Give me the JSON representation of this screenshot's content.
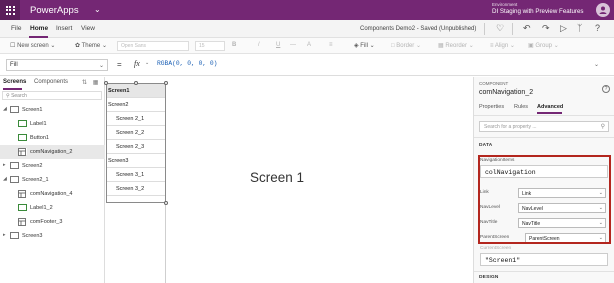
{
  "app": {
    "name": "PowerApps",
    "environment_label": "Environment",
    "environment_name": "DI Staging with Preview Features"
  },
  "menu": {
    "items": [
      "File",
      "Home",
      "Insert",
      "View"
    ],
    "active": "Home",
    "doc_title": "Components Demo2 - Saved (Unpublished)"
  },
  "toolbar": {
    "new_screen": "New screen",
    "theme": "Theme",
    "font": "Open Sans",
    "font_size": "15",
    "bold": "B",
    "italic": "/",
    "underline": "U",
    "strike": "—",
    "font_color": "A",
    "align": "≡",
    "fill": "Fill",
    "border": "Border",
    "reorder": "Reorder",
    "align_menu": "Align",
    "group": "Group"
  },
  "formula_bar": {
    "property": "Fill",
    "equals": "=",
    "fx": "fx",
    "formula": "RGBA(0, 0, 0, 0)"
  },
  "tree": {
    "tabs": [
      "Screens",
      "Components"
    ],
    "active_tab": "Screens",
    "search_placeholder": "Search",
    "rows": [
      {
        "label": "Screen1",
        "level": 0,
        "expanded": true,
        "kind": "screen"
      },
      {
        "label": "Label1",
        "level": 1,
        "kind": "label"
      },
      {
        "label": "Button1",
        "level": 1,
        "kind": "button"
      },
      {
        "label": "comNavigation_2",
        "level": 1,
        "kind": "component",
        "selected": true
      },
      {
        "label": "Screen2",
        "level": 0,
        "expanded": false,
        "kind": "screen"
      },
      {
        "label": "Screen2_1",
        "level": 0,
        "expanded": true,
        "kind": "screen"
      },
      {
        "label": "comNavigation_4",
        "level": 1,
        "kind": "component"
      },
      {
        "label": "Label1_2",
        "level": 1,
        "kind": "label"
      },
      {
        "label": "comFooter_3",
        "level": 1,
        "kind": "component"
      },
      {
        "label": "Screen3",
        "level": 0,
        "expanded": false,
        "kind": "screen"
      }
    ]
  },
  "canvas": {
    "gallery_header": "Screen1",
    "gallery_items": [
      "Screen2",
      "Screen 2_1",
      "Screen 2_2",
      "Screen 2_3",
      "Screen3",
      "Screen 3_1",
      "Screen 3_2"
    ],
    "screen_title": "Screen 1"
  },
  "properties": {
    "component_label": "COMPONENT",
    "component_name": "comNavigation_2",
    "help": "?",
    "tabs": [
      "Properties",
      "Rules",
      "Advanced"
    ],
    "active_tab": "Advanced",
    "search_placeholder": "Search for a property ...",
    "section_data": "DATA",
    "navigation_items_label": "NavigationItems",
    "navigation_items_value": "colNavigation",
    "mappings": [
      {
        "label": "Link",
        "value": "Link"
      },
      {
        "label": "NavLevel",
        "value": "NavLevel"
      },
      {
        "label": "NavTitle",
        "value": "NavTitle"
      },
      {
        "label": "ParentScreen",
        "value": "ParentScreen"
      }
    ],
    "current_screen_label": "CurrentScreen",
    "current_screen_value": "\"Screen1\"",
    "section_design": "DESIGN"
  },
  "colors": {
    "brand": "#742774",
    "highlight": "#b3261e"
  }
}
